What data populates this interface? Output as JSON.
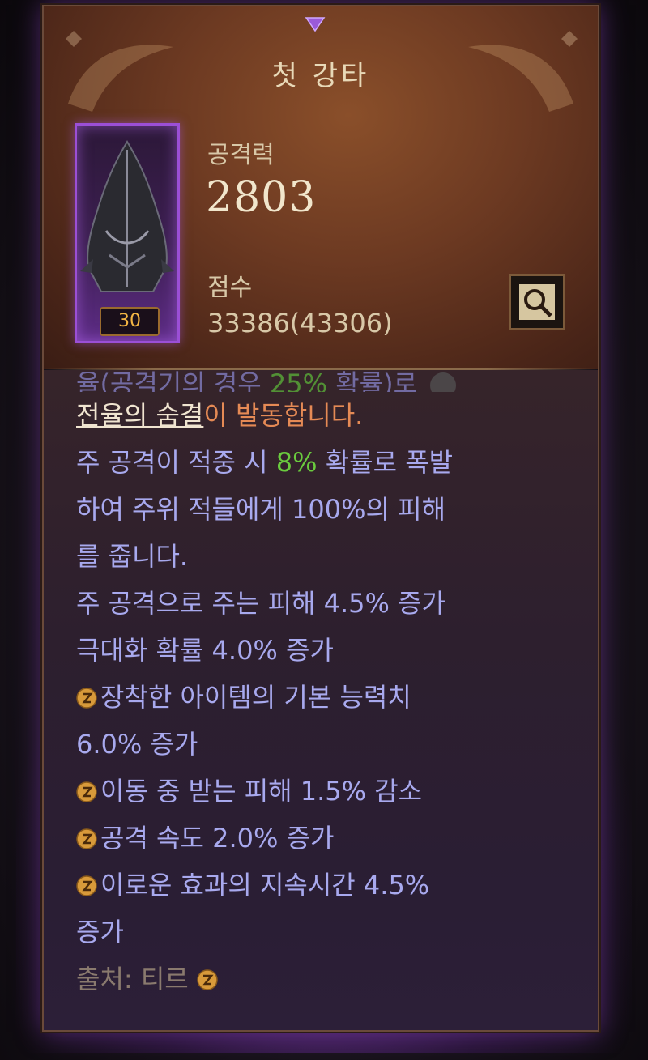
{
  "tooltip": {
    "title": "첫 강타",
    "item_level": "30",
    "attack_label": "공격력",
    "attack_value": "2803",
    "score_label": "점수",
    "score_value": "33386(43306)"
  },
  "description": {
    "cut_line_prefix": "율(공격기의 경우 ",
    "cut_line_green": "25%",
    "cut_line_suffix": " 확률)로",
    "legendary_name": "전율의 숨결",
    "legendary_suffix": "이 발동합니다.",
    "l1_a": "주 공격이 적중 시 ",
    "l1_green": "8%",
    "l1_b": " 확률로 폭발",
    "l2": "하여 주위 적들에게 100%의 피해",
    "l3": "를 줍니다.",
    "l4": "주 공격으로 주는 피해 4.5% 증가",
    "l5": "극대화 확률 4.0% 증가",
    "l6": "장착한 아이템의 기본 능력치",
    "l7": "6.0% 증가",
    "l8": "이동 중 받는 피해 1.5% 감소",
    "l9": "공격 속도 2.0% 증가",
    "l10": "이로운 효과의 지속시간 4.5%",
    "l11": "증가",
    "source": "출처: 티르"
  },
  "colors": {
    "stat_text": "#a8a9ee",
    "highlight_green": "#6acb3e",
    "legendary_orange": "#e58a55",
    "item_frame_purple": "#9b4fd6"
  },
  "icons": {
    "compare": "magnifier-icon",
    "bullet": "rune-bullet-icon",
    "top_gem": "gem-icon",
    "cut_line": "cursor-circle-icon"
  }
}
